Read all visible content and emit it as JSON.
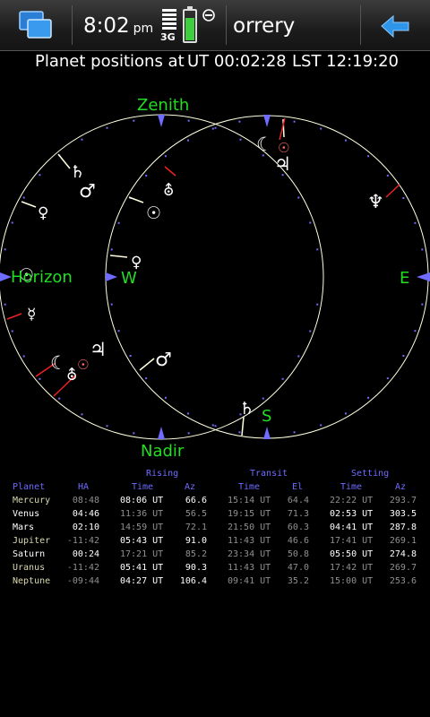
{
  "statusbar": {
    "time": "8:02",
    "ampm": "pm",
    "network": "3G",
    "app_title": "orrery",
    "battery_level": 0.75
  },
  "heading": {
    "label": "Planet positions at",
    "ut": "UT 00:02:28",
    "lst": "LST 12:19:20"
  },
  "sky": {
    "labels": {
      "zenith": "Zenith",
      "horizon": "Horizon",
      "nadir": "Nadir",
      "w": "W",
      "e": "E",
      "s": "S"
    },
    "colors": {
      "ring": "#ffffe0",
      "label": "#22dd22",
      "marker": "#6f6cff",
      "ticks": "#6f6cff",
      "planet_line": "#ee2222"
    },
    "planets": [
      {
        "name": "Mercury",
        "symbol": "☿"
      },
      {
        "name": "Venus",
        "symbol": "♀"
      },
      {
        "name": "Mars",
        "symbol": "♂"
      },
      {
        "name": "Jupiter",
        "symbol": "♃"
      },
      {
        "name": "Saturn",
        "symbol": "♄"
      },
      {
        "name": "Uranus",
        "symbol": "⛢"
      },
      {
        "name": "Neptune",
        "symbol": "♆"
      },
      {
        "name": "Sun",
        "symbol": "☉"
      },
      {
        "name": "Moon",
        "symbol": "☾"
      }
    ]
  },
  "table": {
    "groups": {
      "rising": "Rising",
      "transit": "Transit",
      "setting": "Setting"
    },
    "headers": {
      "planet": "Planet",
      "ha": "HA",
      "time": "Time",
      "az": "Az",
      "el": "El"
    },
    "rows": [
      {
        "planet": "Mercury",
        "ha": "08:48",
        "rise_time": "08:06 UT",
        "rise_az": "66.6",
        "transit_time": "15:14 UT",
        "transit_el": "64.4",
        "set_time": "22:22 UT",
        "set_az": "293.7"
      },
      {
        "planet": "Venus",
        "ha": "04:46",
        "rise_time": "11:36 UT",
        "rise_az": "56.5",
        "transit_time": "19:15 UT",
        "transit_el": "71.3",
        "set_time": "02:53 UT",
        "set_az": "303.5"
      },
      {
        "planet": "Mars",
        "ha": "02:10",
        "rise_time": "14:59 UT",
        "rise_az": "72.1",
        "transit_time": "21:50 UT",
        "transit_el": "60.3",
        "set_time": "04:41 UT",
        "set_az": "287.8"
      },
      {
        "planet": "Jupiter",
        "ha": "-11:42",
        "rise_time": "05:43 UT",
        "rise_az": "91.0",
        "transit_time": "11:43 UT",
        "transit_el": "46.6",
        "set_time": "17:41 UT",
        "set_az": "269.1"
      },
      {
        "planet": "Saturn",
        "ha": "00:24",
        "rise_time": "17:21 UT",
        "rise_az": "85.2",
        "transit_time": "23:34 UT",
        "transit_el": "50.8",
        "set_time": "05:50 UT",
        "set_az": "274.8"
      },
      {
        "planet": "Uranus",
        "ha": "-11:42",
        "rise_time": "05:41 UT",
        "rise_az": "90.3",
        "transit_time": "11:43 UT",
        "transit_el": "47.0",
        "set_time": "17:42 UT",
        "set_az": "269.7"
      },
      {
        "planet": "Neptune",
        "ha": "-09:44",
        "rise_time": "04:27 UT",
        "rise_az": "106.4",
        "transit_time": "09:41 UT",
        "transit_el": "35.2",
        "set_time": "15:00 UT",
        "set_az": "253.6"
      }
    ],
    "row_colors": {
      "Mercury": {
        "name": "#d8d8b0",
        "ha": "#909090",
        "rise_time": "#ffffff",
        "rise_az": "#ffffff",
        "transit_time": "#909090",
        "transit_el": "#909090",
        "set_time": "#909090",
        "set_az": "#909090"
      },
      "Venus": {
        "name": "#ffffff",
        "ha": "#ffffff",
        "rise_time": "#909090",
        "rise_az": "#909090",
        "transit_time": "#909090",
        "transit_el": "#909090",
        "set_time": "#ffffff",
        "set_az": "#ffffff"
      },
      "Mars": {
        "name": "#ffffff",
        "ha": "#ffffff",
        "rise_time": "#909090",
        "rise_az": "#909090",
        "transit_time": "#909090",
        "transit_el": "#909090",
        "set_time": "#ffffff",
        "set_az": "#ffffff"
      },
      "Jupiter": {
        "name": "#d8d8b0",
        "ha": "#909090",
        "rise_time": "#ffffff",
        "rise_az": "#ffffff",
        "transit_time": "#909090",
        "transit_el": "#909090",
        "set_time": "#909090",
        "set_az": "#909090"
      },
      "Saturn": {
        "name": "#ffffff",
        "ha": "#ffffff",
        "rise_time": "#909090",
        "rise_az": "#909090",
        "transit_time": "#909090",
        "transit_el": "#909090",
        "set_time": "#ffffff",
        "set_az": "#ffffff"
      },
      "Uranus": {
        "name": "#d8d8b0",
        "ha": "#909090",
        "rise_time": "#ffffff",
        "rise_az": "#ffffff",
        "transit_time": "#909090",
        "transit_el": "#909090",
        "set_time": "#909090",
        "set_az": "#909090"
      },
      "Neptune": {
        "name": "#d8d8b0",
        "ha": "#909090",
        "rise_time": "#ffffff",
        "rise_az": "#ffffff",
        "transit_time": "#909090",
        "transit_el": "#909090",
        "set_time": "#909090",
        "set_az": "#909090"
      }
    }
  }
}
